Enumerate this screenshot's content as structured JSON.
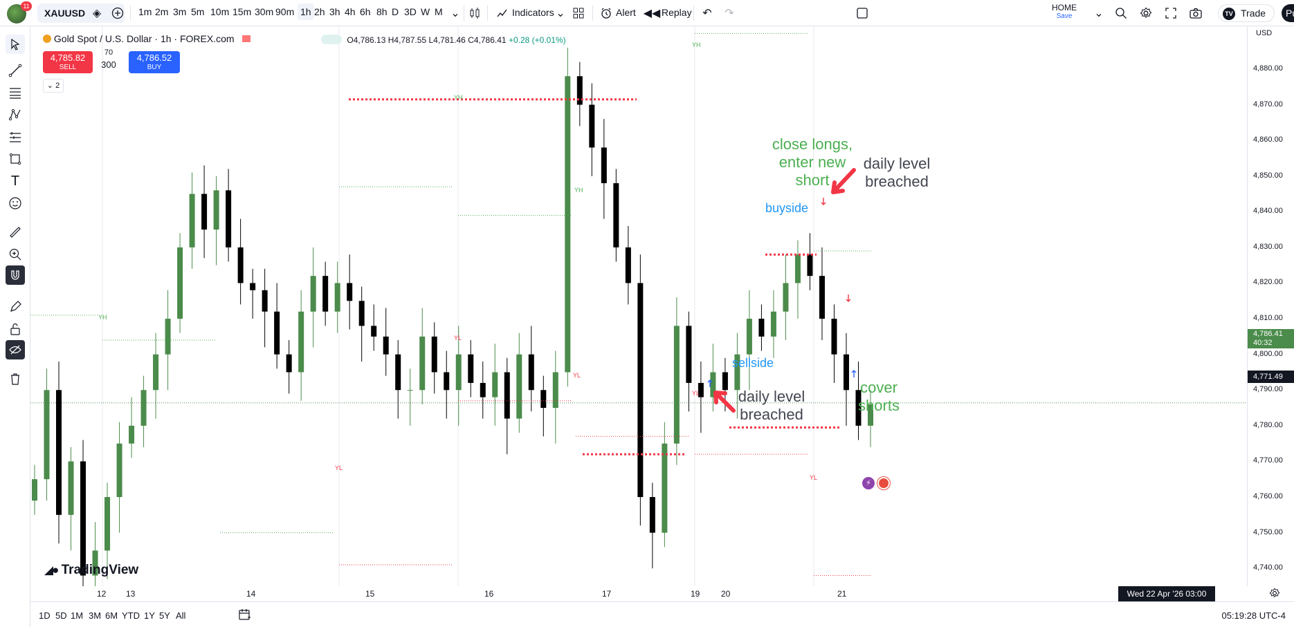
{
  "topbar": {
    "notification_count": "11",
    "symbol": "XAUUSD",
    "timeframes": [
      "1m",
      "2m",
      "3m",
      "5m",
      "10m",
      "15m",
      "30m",
      "90m",
      "1h",
      "2h",
      "3h",
      "4h",
      "6h",
      "8h",
      "D",
      "3D",
      "W",
      "M"
    ],
    "active_timeframe": "1h",
    "indicators_label": "Indicators",
    "alert_label": "Alert",
    "replay_label": "Replay",
    "layout_name": "HOME",
    "layout_save": "Save",
    "trade_label": "Trade",
    "publish_label": "Pu"
  },
  "legend": {
    "title": "Gold Spot / U.S. Dollar · 1h · FOREX.com",
    "open": "O4,786.13",
    "high": "H4,787.55",
    "low": "L4,781.46",
    "close": "C4,786.41",
    "change": "+0.28 (+0.01%)"
  },
  "order": {
    "sell_price": "4,785.82",
    "sell_label": "SELL",
    "buy_price": "4,786.52",
    "buy_label": "BUY",
    "spread_small": "70",
    "spread_big": "300",
    "collapse_label": "2"
  },
  "logo": "TradingView",
  "price_axis": {
    "currency": "USD",
    "labels": [
      "4,880.00",
      "4,870.00",
      "4,860.00",
      "4,850.00",
      "4,840.00",
      "4,830.00",
      "4,820.00",
      "4,810.00",
      "4,800.00",
      "4,790.00",
      "4,780.00",
      "4,770.00",
      "4,760.00",
      "4,750.00",
      "4,740.00"
    ],
    "current_price": "4,786.41",
    "countdown": "40:32",
    "crosshair_price": "4,771.49"
  },
  "time_axis": {
    "labels": [
      "12",
      "13",
      "14",
      "15",
      "16",
      "17",
      "19",
      "20",
      "21"
    ],
    "crosshair_time": "Wed 22 Apr '26  03:00"
  },
  "bottom": {
    "ranges": [
      "1D",
      "5D",
      "1M",
      "3M",
      "6M",
      "YTD",
      "1Y",
      "5Y",
      "All"
    ],
    "clock": "05:19:28 UTC-4"
  },
  "annotations": {
    "close_longs": [
      "close longs,",
      "enter new",
      "short"
    ],
    "daily_level_top": [
      "daily level",
      "breached"
    ],
    "buyside": "buyside",
    "sellside": "sellside",
    "daily_level_bottom": [
      "daily level",
      "breached"
    ],
    "cover_shorts": [
      "cover",
      "shorts"
    ],
    "yh": "YH",
    "yl": "YL"
  },
  "colors": {
    "up": "#4b8b4b",
    "down": "#000000",
    "sell": "#f23645",
    "buy": "#2962ff",
    "annotation_green": "#4caf50",
    "annotation_blue": "#2196f3",
    "level_red": "#f23645"
  },
  "chart_data": {
    "type": "candlestick",
    "symbol": "XAUUSD",
    "ylim": [
      4735,
      4892
    ],
    "x_labels": [
      "12",
      "13",
      "14",
      "15",
      "16",
      "17",
      "19",
      "20",
      "21"
    ],
    "candles_close_approx": [
      4765,
      4790,
      4755,
      4770,
      4738,
      4745,
      4760,
      4775,
      4780,
      4790,
      4800,
      4810,
      4830,
      4845,
      4835,
      4846,
      4830,
      4820,
      4818,
      4812,
      4800,
      4795,
      4812,
      4822,
      4812,
      4820,
      4815,
      4808,
      4805,
      4800,
      4790,
      4790,
      4805,
      4795,
      4790,
      4800,
      4792,
      4788,
      4795,
      4782,
      4800,
      4790,
      4785,
      4795,
      4878,
      4870,
      4858,
      4848,
      4830,
      4820,
      4760,
      4750,
      4775,
      4808,
      4792,
      4788,
      4795,
      4790,
      4800,
      4810,
      4805,
      4812,
      4820,
      4828,
      4822,
      4810,
      4800,
      4790,
      4780,
      4786
    ]
  }
}
